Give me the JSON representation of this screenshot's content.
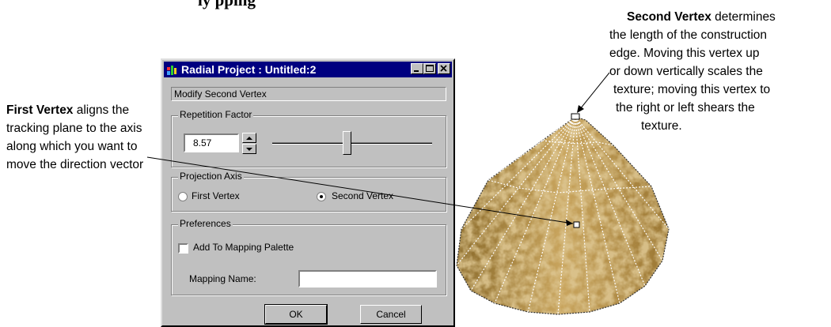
{
  "caption_title": "ly                                                                  pping",
  "dialog": {
    "title": "Radial Project : Untitled:2",
    "status": "Modify Second Vertex",
    "repetition_factor": {
      "label": "Repetition Factor",
      "value": "8.57",
      "slider_level": 0.55
    },
    "projection_axis": {
      "label": "Projection Axis",
      "options": [
        {
          "label": "First Vertex",
          "selected": false
        },
        {
          "label": "Second Vertex",
          "selected": true
        }
      ]
    },
    "preferences": {
      "label": "Preferences",
      "add_to_palette": {
        "label": "Add To Mapping Palette",
        "checked": false
      },
      "mapping_name": {
        "label": "Mapping Name:",
        "value": ""
      }
    },
    "buttons": {
      "ok": "OK",
      "cancel": "Cancel"
    }
  },
  "callouts": {
    "first_vertex": {
      "term": "First Vertex",
      "text": " aligns the tracking plane to the axis along which you want to move the direction vector"
    },
    "second_vertex": {
      "term": "Second Vertex",
      "lines": [
        " determines",
        "the length of the construction",
        "edge. Moving this vertex up",
        "or down vertically scales the",
        "texture; moving this vertex to",
        "the right or left shears the",
        "texture."
      ]
    }
  },
  "colors": {
    "titlebar": "#000080",
    "dialog_face": "#c0c0c0",
    "texture": "#b8944a"
  },
  "icons": [
    "app-icon",
    "minimize-icon",
    "maximize-icon",
    "close-icon",
    "spin-up-icon",
    "spin-down-icon"
  ]
}
